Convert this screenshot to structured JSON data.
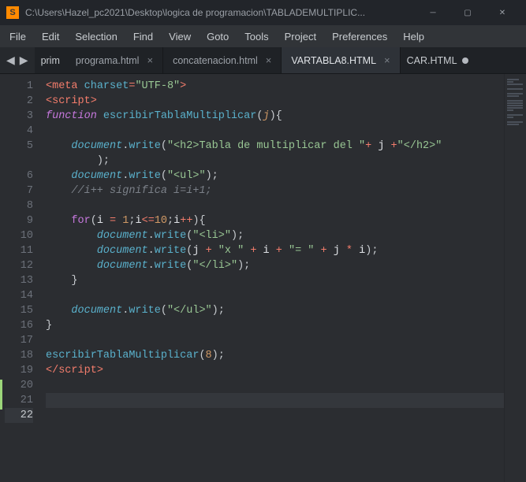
{
  "titlebar": {
    "app_letter": "S",
    "title": "C:\\Users\\Hazel_pc2021\\Desktop\\logica de programacion\\TABLADEMULTIPLIC..."
  },
  "menu": {
    "items": [
      "File",
      "Edit",
      "Selection",
      "Find",
      "View",
      "Goto",
      "Tools",
      "Project",
      "Preferences",
      "Help"
    ]
  },
  "tabs": {
    "overflow_left": "prim",
    "overflow_right": "CAR.HTML",
    "items": [
      {
        "label": "programa.html",
        "active": false
      },
      {
        "label": "concatenacion.html",
        "active": false
      },
      {
        "label": "VARTABLA8.HTML",
        "active": true
      }
    ]
  },
  "editor": {
    "active_line": 22,
    "lines": [
      {
        "n": 1,
        "html": "<span class='c-op'>&lt;</span><span class='c-tag'>meta</span> <span class='c-fn'>charset</span><span class='c-op'>=</span><span class='c-str'>\"UTF-8\"</span><span class='c-op'>&gt;</span>"
      },
      {
        "n": 2,
        "html": "<span class='c-op'>&lt;</span><span class='c-tag'>script</span><span class='c-op'>&gt;</span>"
      },
      {
        "n": 3,
        "html": "<span class='c-kw'>function</span> <span class='c-fn'>escribirTablaMultiplicar</span><span class='c-punc'>(</span><span class='c-param'>j</span><span class='c-punc'>){</span>"
      },
      {
        "n": 4,
        "html": ""
      },
      {
        "n": 5,
        "html": "    <span class='c-var'>document</span><span class='c-punc'>.</span><span class='c-fn'>write</span><span class='c-punc'>(</span><span class='c-str'>\"&lt;h2&gt;Tabla de multiplicar del \"</span><span class='c-op'>+</span> <span class='c-white'>j</span> <span class='c-op'>+</span><span class='c-str'>\"&lt;/h2&gt;\"</span>\n        <span class='c-punc'>);</span>"
      },
      {
        "n": 6,
        "html": ""
      },
      {
        "n": 7,
        "html": "    <span class='c-var'>document</span><span class='c-punc'>.</span><span class='c-fn'>write</span><span class='c-punc'>(</span><span class='c-str'>\"&lt;ul&gt;\"</span><span class='c-punc'>);</span>"
      },
      {
        "n": 8,
        "html": "    <span class='c-cmt'>//i++ significa i=i+1;</span>"
      },
      {
        "n": 9,
        "html": ""
      },
      {
        "n": 10,
        "html": "    <span class='c-kw2'>for</span><span class='c-punc'>(</span><span class='c-white'>i</span> <span class='c-op'>=</span> <span class='c-num'>1</span><span class='c-punc'>;</span><span class='c-white'>i</span><span class='c-op'>&lt;=</span><span class='c-num'>10</span><span class='c-punc'>;</span><span class='c-white'>i</span><span class='c-op'>++</span><span class='c-punc'>){</span>"
      },
      {
        "n": 11,
        "html": "        <span class='c-var'>document</span><span class='c-punc'>.</span><span class='c-fn'>write</span><span class='c-punc'>(</span><span class='c-str'>\"&lt;li&gt;\"</span><span class='c-punc'>);</span>"
      },
      {
        "n": 12,
        "html": "        <span class='c-var'>document</span><span class='c-punc'>.</span><span class='c-fn'>write</span><span class='c-punc'>(</span><span class='c-white'>j</span> <span class='c-op'>+</span> <span class='c-str'>\"x \"</span> <span class='c-op'>+</span> <span class='c-white'>i</span> <span class='c-op'>+</span> <span class='c-str'>\"= \"</span> <span class='c-op'>+</span> <span class='c-white'>j</span> <span class='c-op'>*</span> <span class='c-white'>i</span><span class='c-punc'>);</span>"
      },
      {
        "n": 13,
        "html": "        <span class='c-var'>document</span><span class='c-punc'>.</span><span class='c-fn'>write</span><span class='c-punc'>(</span><span class='c-str'>\"&lt;/li&gt;\"</span><span class='c-punc'>);</span>"
      },
      {
        "n": 14,
        "html": "    <span class='c-punc'>}</span>"
      },
      {
        "n": 15,
        "html": ""
      },
      {
        "n": 16,
        "html": "    <span class='c-var'>document</span><span class='c-punc'>.</span><span class='c-fn'>write</span><span class='c-punc'>(</span><span class='c-str'>\"&lt;/ul&gt;\"</span><span class='c-punc'>);</span>"
      },
      {
        "n": 17,
        "html": "<span class='c-punc'>}</span>"
      },
      {
        "n": 18,
        "html": ""
      },
      {
        "n": 19,
        "html": "<span class='c-fn'>escribirTablaMultiplicar</span><span class='c-punc'>(</span><span class='c-num'>8</span><span class='c-punc'>);</span>"
      },
      {
        "n": 20,
        "html": "<span class='c-op'>&lt;/</span><span class='c-tag'>script</span><span class='c-op'>&gt;</span>"
      },
      {
        "n": 21,
        "html": ""
      },
      {
        "n": 22,
        "html": ""
      }
    ]
  }
}
